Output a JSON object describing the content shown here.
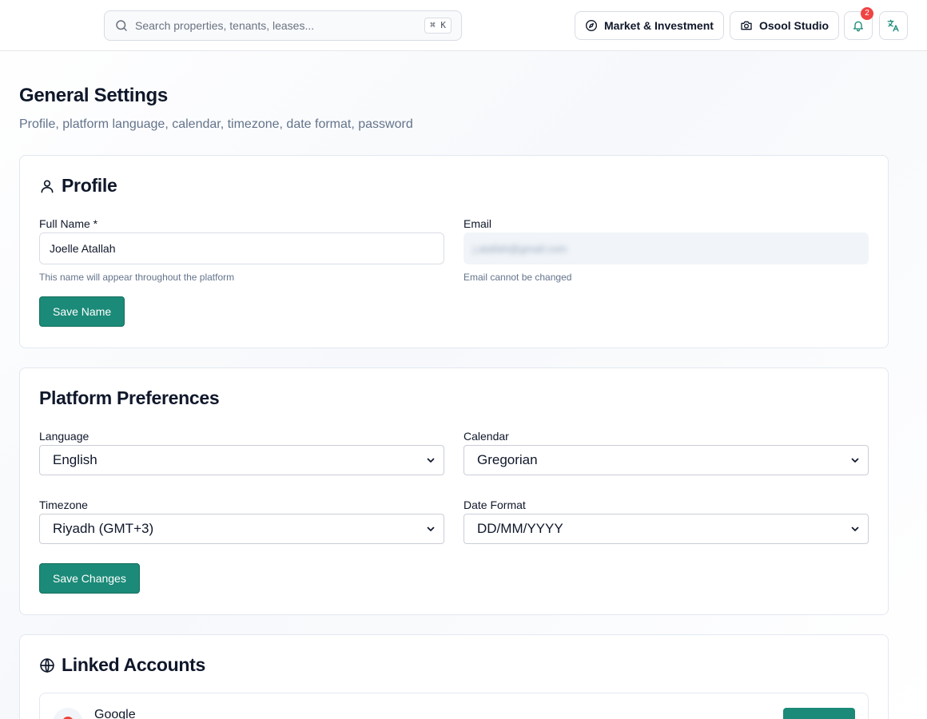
{
  "topbar": {
    "search": {
      "placeholder": "Search properties, tenants, leases...",
      "shortcut": "⌘ K"
    },
    "market_label": "Market & Investment",
    "studio_label": "Osool Studio",
    "notifications_count": "2"
  },
  "page": {
    "title": "General Settings",
    "subtitle": "Profile, platform language, calendar, timezone, date format, password"
  },
  "profile": {
    "title": "Profile",
    "full_name_label": "Full Name *",
    "full_name_value": "Joelle Atallah",
    "full_name_helper": "This name will appear throughout the platform",
    "email_label": "Email",
    "email_value": "j.atallah@gmail.com",
    "email_helper": "Email cannot be changed",
    "save_label": "Save Name"
  },
  "preferences": {
    "title": "Platform Preferences",
    "language_label": "Language",
    "language_value": "English",
    "calendar_label": "Calendar",
    "calendar_value": "Gregorian",
    "timezone_label": "Timezone",
    "timezone_value": "Riyadh (GMT+3)",
    "date_format_label": "Date Format",
    "date_format_value": "DD/MM/YYYY",
    "save_label": "Save Changes"
  },
  "linked_accounts": {
    "title": "Linked Accounts",
    "accounts": [
      {
        "name": "Google"
      }
    ]
  },
  "colors": {
    "accent": "#1b8a78",
    "badge": "#ef4444",
    "muted_text": "#64748b",
    "border": "#e2e8f0"
  }
}
